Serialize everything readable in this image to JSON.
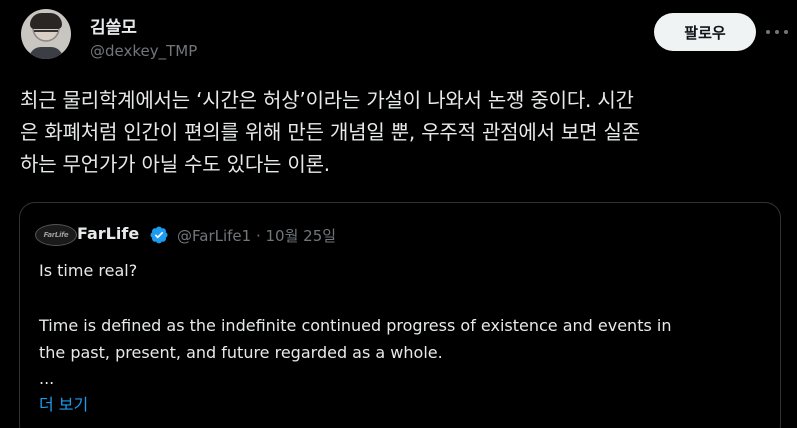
{
  "author": {
    "display_name": "김쓸모",
    "handle": "@dexkey_TMP"
  },
  "follow_button_label": "팔로우",
  "tweet_text_lines": [
    "최근 물리학계에서는 ‘시간은 허상’이라는 가설이 나와서 논쟁 중이다. 시간",
    "은 화폐처럼 인간이 편의를 위해 만든 개념일 뿐, 우주적 관점에서 보면 실존",
    "하는 무언가가 아닐 수도 있다는 이론."
  ],
  "quoted_tweet": {
    "logo_text": "FarLife",
    "display_name": "FarLife",
    "handle_and_date": "@FarLife1 · 10월 25일",
    "lines": [
      "Is time real?",
      "Time is defined as the indefinite continued progress of existence and events in",
      "the past, present, and future regarded as a whole.",
      "..."
    ],
    "show_more_label": "더 보기"
  },
  "colors": {
    "background": "#000000",
    "text": "#e7e9ea",
    "muted": "#71767b",
    "accent": "#1d9bf0",
    "border": "#2f3336"
  },
  "icons": {
    "verified": "verified-badge-icon",
    "more": "more-horizontal-icon"
  }
}
